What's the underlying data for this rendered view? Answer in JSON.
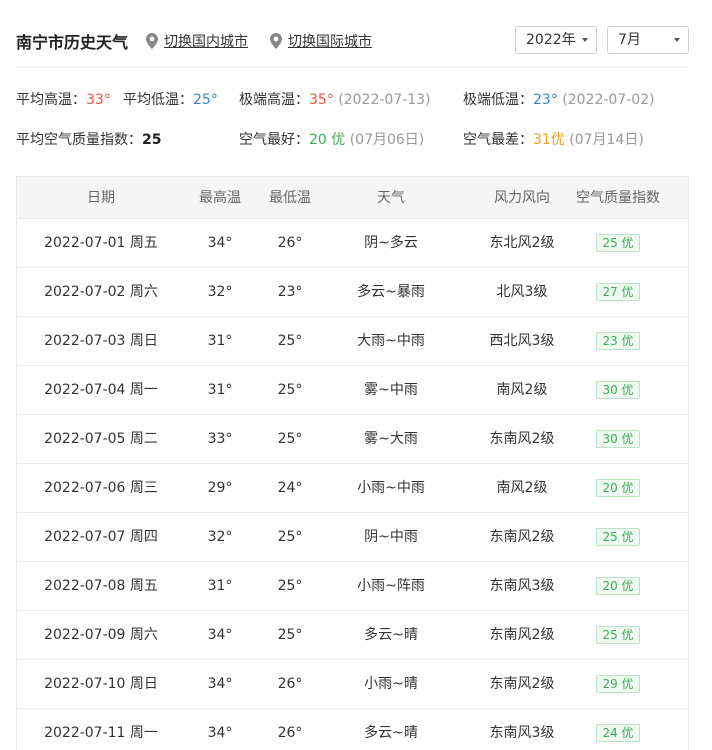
{
  "header": {
    "title": "南宁市历史天气",
    "links": {
      "domestic": "切换国内城市",
      "international": "切换国际城市"
    },
    "year_select": "2022年",
    "month_select": "7月"
  },
  "summary": {
    "avg_high_label": "平均高温：",
    "avg_high_value": "33°",
    "avg_low_label": "平均低温：",
    "avg_low_value": "25°",
    "extreme_high_label": "极端高温：",
    "extreme_high_value": "35°",
    "extreme_high_date": "(2022-07-13)",
    "extreme_low_label": "极端低温：",
    "extreme_low_value": "23°",
    "extreme_low_date": "(2022-07-02)",
    "avg_aqi_label": "平均空气质量指数：",
    "avg_aqi_value": "25",
    "best_air_label": "空气最好：",
    "best_air_value": "20 优",
    "best_air_date": "(07月06日)",
    "worst_air_label": "空气最差：",
    "worst_air_value": "31优",
    "worst_air_date": "(07月14日)"
  },
  "table": {
    "headers": [
      "日期",
      "最高温",
      "最低温",
      "天气",
      "风力风向",
      "空气质量指数"
    ],
    "rows": [
      {
        "date": "2022-07-01 周五",
        "high": "34°",
        "low": "26°",
        "weather": "阴~多云",
        "wind": "东北风2级",
        "aqi": "25 优"
      },
      {
        "date": "2022-07-02 周六",
        "high": "32°",
        "low": "23°",
        "weather": "多云~暴雨",
        "wind": "北风3级",
        "aqi": "27 优"
      },
      {
        "date": "2022-07-03 周日",
        "high": "31°",
        "low": "25°",
        "weather": "大雨~中雨",
        "wind": "西北风3级",
        "aqi": "23 优"
      },
      {
        "date": "2022-07-04 周一",
        "high": "31°",
        "low": "25°",
        "weather": "雾~中雨",
        "wind": "南风2级",
        "aqi": "30 优"
      },
      {
        "date": "2022-07-05 周二",
        "high": "33°",
        "low": "25°",
        "weather": "雾~大雨",
        "wind": "东南风2级",
        "aqi": "30 优"
      },
      {
        "date": "2022-07-06 周三",
        "high": "29°",
        "low": "24°",
        "weather": "小雨~中雨",
        "wind": "南风2级",
        "aqi": "20 优"
      },
      {
        "date": "2022-07-07 周四",
        "high": "32°",
        "low": "25°",
        "weather": "阴~中雨",
        "wind": "东南风2级",
        "aqi": "25 优"
      },
      {
        "date": "2022-07-08 周五",
        "high": "31°",
        "low": "25°",
        "weather": "小雨~阵雨",
        "wind": "东南风3级",
        "aqi": "20 优"
      },
      {
        "date": "2022-07-09 周六",
        "high": "34°",
        "low": "25°",
        "weather": "多云~晴",
        "wind": "东南风2级",
        "aqi": "25 优"
      },
      {
        "date": "2022-07-10 周日",
        "high": "34°",
        "low": "26°",
        "weather": "小雨~晴",
        "wind": "东南风2级",
        "aqi": "29 优"
      },
      {
        "date": "2022-07-11 周一",
        "high": "34°",
        "low": "26°",
        "weather": "多云~晴",
        "wind": "东南风3级",
        "aqi": "24 优"
      }
    ]
  },
  "colors": {
    "high_temp": "#e9573d",
    "low_temp": "#3a86c8",
    "aqi_good": "#3fab57",
    "aqi_worst": "#f0a020"
  },
  "icons": {
    "location": "map-pin-icon",
    "dropdown": "caret-down-icon"
  }
}
